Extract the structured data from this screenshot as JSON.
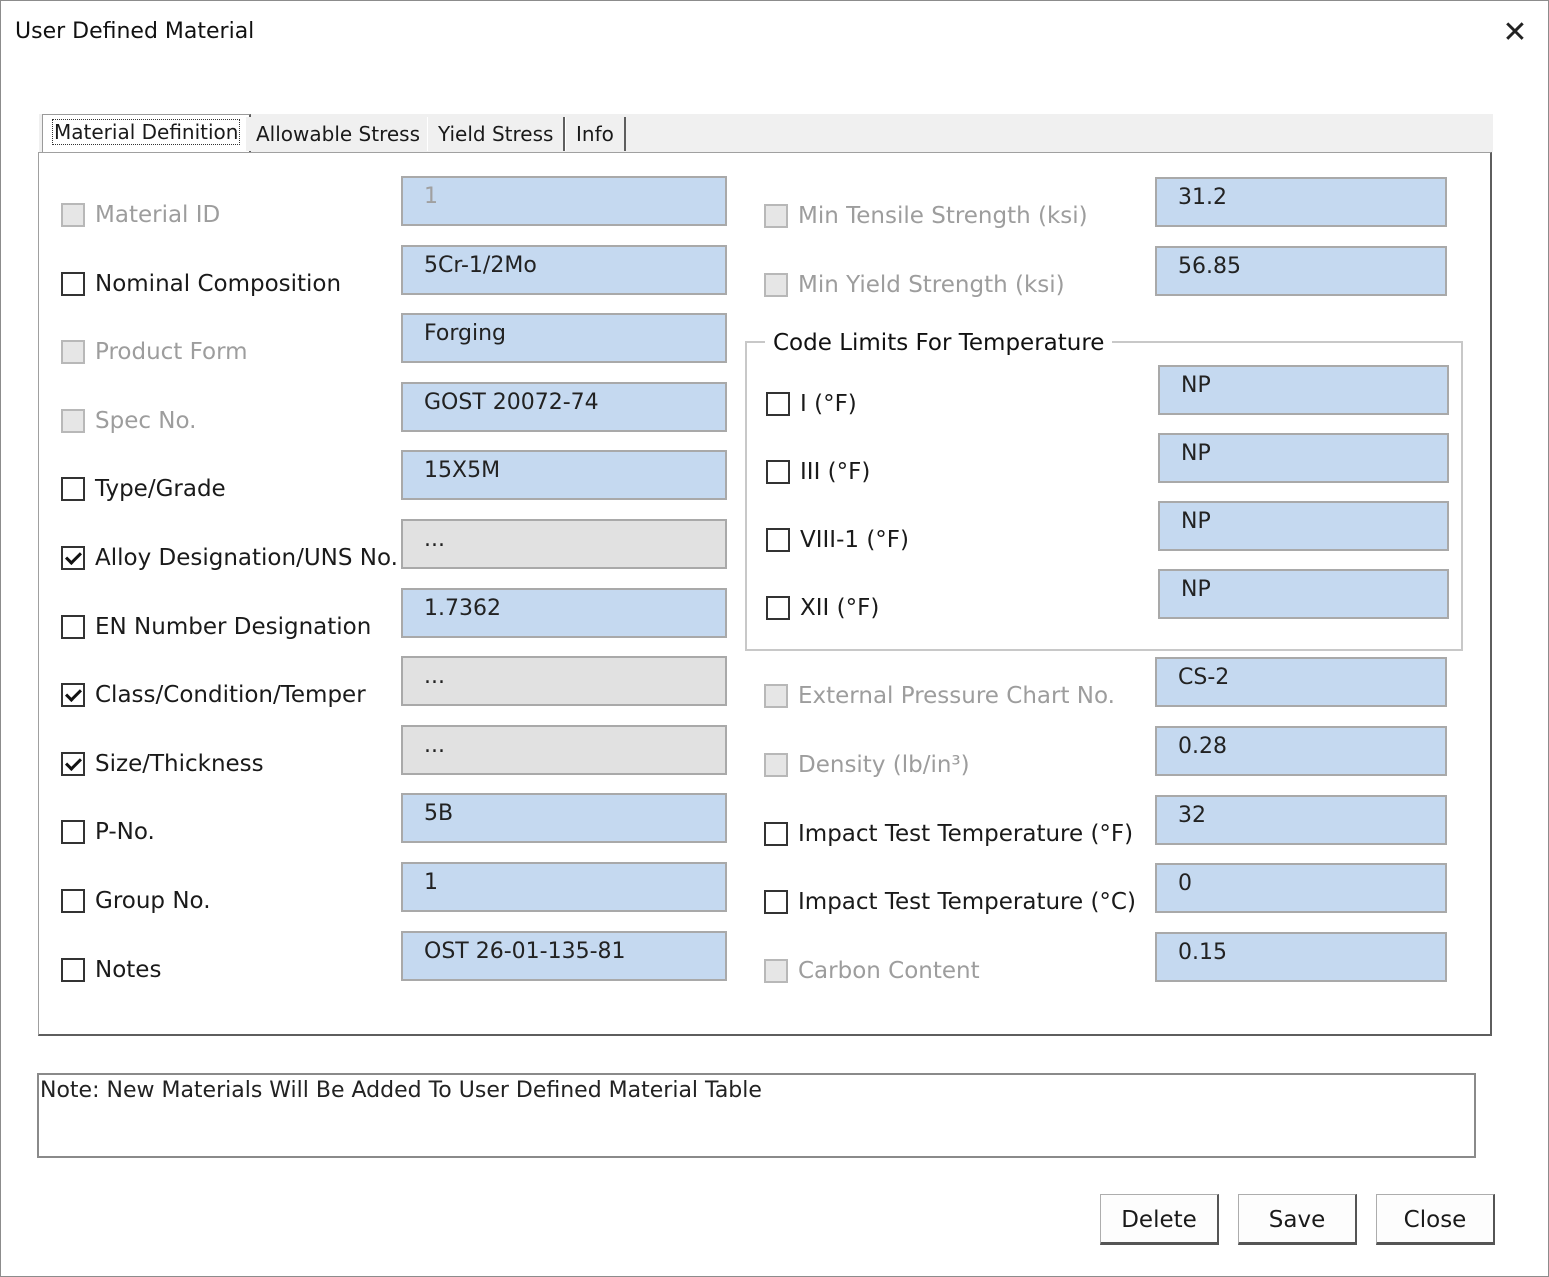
{
  "window": {
    "title": "User Defined Material",
    "close_glyph": "✕"
  },
  "tabs": [
    {
      "label": "Material Definition"
    },
    {
      "label": "Allowable Stress"
    },
    {
      "label": "Yield Stress"
    },
    {
      "label": "Info"
    }
  ],
  "left_fields": [
    {
      "label": "Material ID",
      "value": "1",
      "checked": false,
      "enabled": false
    },
    {
      "label": "Nominal Composition",
      "value": "5Cr-1/2Mo",
      "checked": false,
      "enabled": true
    },
    {
      "label": "Product Form",
      "value": "Forging",
      "checked": false,
      "enabled": false
    },
    {
      "label": "Spec No.",
      "value": "GOST 20072-74",
      "checked": false,
      "enabled": false
    },
    {
      "label": "Type/Grade",
      "value": "15X5M",
      "checked": false,
      "enabled": true
    },
    {
      "label": "Alloy Designation/UNS No.",
      "value": "...",
      "checked": true,
      "enabled": true
    },
    {
      "label": "EN Number Designation",
      "value": "1.7362",
      "checked": false,
      "enabled": true
    },
    {
      "label": "Class/Condition/Temper",
      "value": "...",
      "checked": true,
      "enabled": true
    },
    {
      "label": "Size/Thickness",
      "value": "...",
      "checked": true,
      "enabled": true
    },
    {
      "label": "P-No.",
      "value": "5B",
      "checked": false,
      "enabled": true
    },
    {
      "label": "Group No.",
      "value": "1",
      "checked": false,
      "enabled": true
    },
    {
      "label": "Notes",
      "value": "OST 26-01-135-81",
      "checked": false,
      "enabled": true
    }
  ],
  "right_top_fields": [
    {
      "label": "Min Tensile Strength (ksi)",
      "value": "31.2",
      "checked": false,
      "enabled": false
    },
    {
      "label": "Min Yield Strength (ksi)",
      "value": "56.85",
      "checked": false,
      "enabled": false
    }
  ],
  "code_limits": {
    "title": "Code Limits For Temperature",
    "items": [
      {
        "label": "I (°F)",
        "value": "NP",
        "checked": false
      },
      {
        "label": "III (°F)",
        "value": "NP",
        "checked": false
      },
      {
        "label": "VIII-1 (°F)",
        "value": "NP",
        "checked": false
      },
      {
        "label": "XII (°F)",
        "value": "NP",
        "checked": false
      }
    ]
  },
  "right_bottom_fields": [
    {
      "label": "External Pressure Chart No.",
      "value": "CS-2",
      "checked": false,
      "enabled": false
    },
    {
      "label": "Density (lb/in³)",
      "value": "0.28",
      "checked": false,
      "enabled": false
    },
    {
      "label": "Impact Test Temperature (°F)",
      "value": "32",
      "checked": false,
      "enabled": true
    },
    {
      "label": "Impact Test Temperature (°C)",
      "value": "0",
      "checked": false,
      "enabled": true
    },
    {
      "label": "Carbon Content",
      "value": "0.15",
      "checked": false,
      "enabled": false
    }
  ],
  "note": "Note: New Materials Will Be Added To User Defined Material Table",
  "buttons": {
    "delete": "Delete",
    "save": "Save",
    "close": "Close"
  }
}
